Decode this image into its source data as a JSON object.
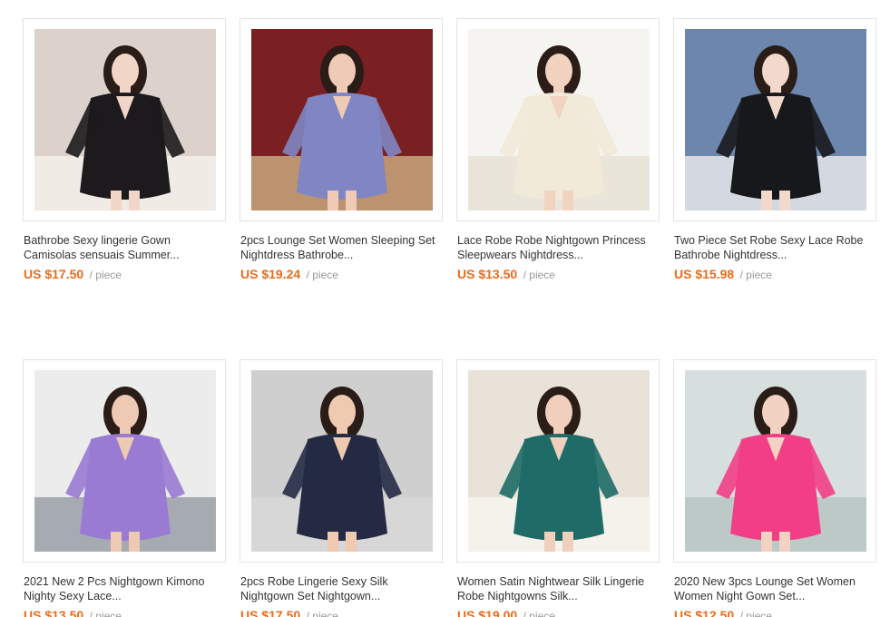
{
  "products": [
    {
      "title": "Bathrobe Sexy lingerie Gown Camisolas sensuais Summer...",
      "price": "US $17.50",
      "unit": "/ piece",
      "bg": "#dcd2cb",
      "robe": "#1c1a1d",
      "skin": "#f1d6c8",
      "accent": "#f4f0ea"
    },
    {
      "title": "2pcs Lounge Set Women Sleeping Set Nightdress Bathrobe...",
      "price": "US $19.24",
      "unit": "/ piece",
      "bg": "#7a1f22",
      "robe": "#7f86c3",
      "skin": "#efcbb5",
      "accent": "#c9a77c"
    },
    {
      "title": "Lace Robe Robe Nightgown Princess Sleepwears Nightdress...",
      "price": "US $13.50",
      "unit": "/ piece",
      "bg": "#f6f4f1",
      "robe": "#f2ead9",
      "skin": "#f1d3c0",
      "accent": "#e8e2d6"
    },
    {
      "title": "Two Piece Set Robe Sexy Lace Robe Bathrobe Nightdress...",
      "price": "US $15.98",
      "unit": "/ piece",
      "bg": "#6d86ad",
      "robe": "#17181c",
      "skin": "#f3d9cc",
      "accent": "#e6e6ea"
    },
    {
      "title": "2021 New 2 Pcs Nightgown Kimono Nighty Sexy Lace...",
      "price": "US $13.50",
      "unit": "/ piece",
      "bg": "#ececec",
      "robe": "#9a7bd4",
      "skin": "#eec9b3",
      "accent": "#9aa0a8"
    },
    {
      "title": "2pcs Robe Lingerie Sexy Silk Nightgown Set Nightgown...",
      "price": "US $17.50",
      "unit": "/ piece",
      "bg": "#cfcfcf",
      "robe": "#242a44",
      "skin": "#efc9b0",
      "accent": "#d8d8d8"
    },
    {
      "title": "Women Satin Nightwear Silk Lingerie Robe Nightgowns Silk...",
      "price": "US $19.00",
      "unit": "/ piece",
      "bg": "#e9e2d8",
      "robe": "#1f6b67",
      "skin": "#f0cfbc",
      "accent": "#f7f4ef"
    },
    {
      "title": "2020 New 3pcs Lounge Set Women Women Night Gown Set...",
      "price": "US $12.50",
      "unit": "/ piece",
      "bg": "#d6dfdd",
      "robe": "#f23e86",
      "skin": "#f2d2c2",
      "accent": "#b9c6c3"
    }
  ]
}
